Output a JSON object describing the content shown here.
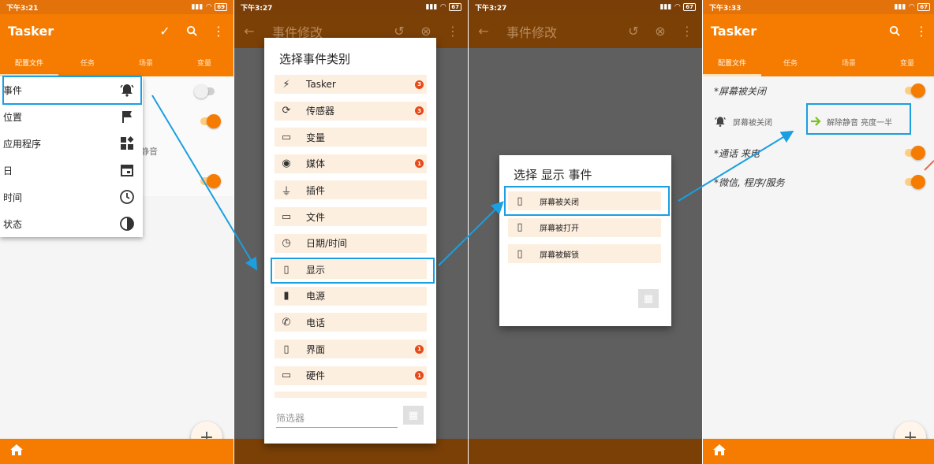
{
  "panel1": {
    "status": {
      "time": "下午3:21",
      "battery": "69"
    },
    "appbar": {
      "title": "Tasker",
      "icons": [
        "check-icon",
        "search-icon",
        "more-icon"
      ]
    },
    "tabs": [
      "配置文件",
      "任务",
      "场景",
      "变量"
    ],
    "profile_fragment": "静音",
    "menu": [
      {
        "label": "事件",
        "icon": "bell-icon"
      },
      {
        "label": "位置",
        "icon": "flag-icon"
      },
      {
        "label": "应用程序",
        "icon": "apps-icon"
      },
      {
        "label": "日",
        "icon": "calendar-icon"
      },
      {
        "label": "时间",
        "icon": "clock-icon"
      },
      {
        "label": "状态",
        "icon": "contrast-icon"
      }
    ],
    "fab": "+"
  },
  "panel2": {
    "status": {
      "time": "下午3:27",
      "battery": "67"
    },
    "appbar": {
      "title": "事件修改"
    },
    "dialog_title": "选择事件类别",
    "categories": [
      {
        "label": "Tasker",
        "icon": "bolt-icon",
        "badge": "3"
      },
      {
        "label": "传感器",
        "icon": "rotate-icon",
        "badge": "3"
      },
      {
        "label": "变量",
        "icon": "tag-icon",
        "badge": ""
      },
      {
        "label": "媒体",
        "icon": "camera-icon",
        "badge": "1"
      },
      {
        "label": "插件",
        "icon": "plug-icon",
        "badge": ""
      },
      {
        "label": "文件",
        "icon": "folder-icon",
        "badge": ""
      },
      {
        "label": "日期/时间",
        "icon": "clock-icon",
        "badge": ""
      },
      {
        "label": "显示",
        "icon": "phone-icon",
        "badge": ""
      },
      {
        "label": "电源",
        "icon": "battery-icon",
        "badge": ""
      },
      {
        "label": "电话",
        "icon": "phone-call-icon",
        "badge": ""
      },
      {
        "label": "界面",
        "icon": "phone-icon",
        "badge": "1"
      },
      {
        "label": "硬件",
        "icon": "laptop-icon",
        "badge": "1"
      }
    ],
    "filter_placeholder": "筛选器"
  },
  "panel3": {
    "status": {
      "time": "下午3:27",
      "battery": "67"
    },
    "appbar": {
      "title": "事件修改"
    },
    "dialog_title": "选择 显示 事件",
    "events": [
      {
        "label": "屏幕被关闭",
        "icon": "phone-icon"
      },
      {
        "label": "屏幕被打开",
        "icon": "phone-icon"
      },
      {
        "label": "屏幕被解锁",
        "icon": "phone-icon"
      }
    ]
  },
  "panel4": {
    "status": {
      "time": "下午3:33",
      "battery": "67"
    },
    "appbar": {
      "title": "Tasker",
      "icons": [
        "search-icon",
        "more-icon"
      ]
    },
    "tabs": [
      "配置文件",
      "任务",
      "场景",
      "变量"
    ],
    "profiles": [
      {
        "label": "*屏幕被关闭"
      },
      {
        "label": "*通话 来电"
      },
      {
        "label": "*微信, 程序/服务"
      }
    ],
    "detail": {
      "context": "屏幕被关闭",
      "task": "解除静音 亮度一半"
    },
    "fab": "+"
  },
  "colors": {
    "accent": "#f57c00",
    "highlight": "#1a9fe0",
    "dim_overlay": "#5f5f5f"
  }
}
